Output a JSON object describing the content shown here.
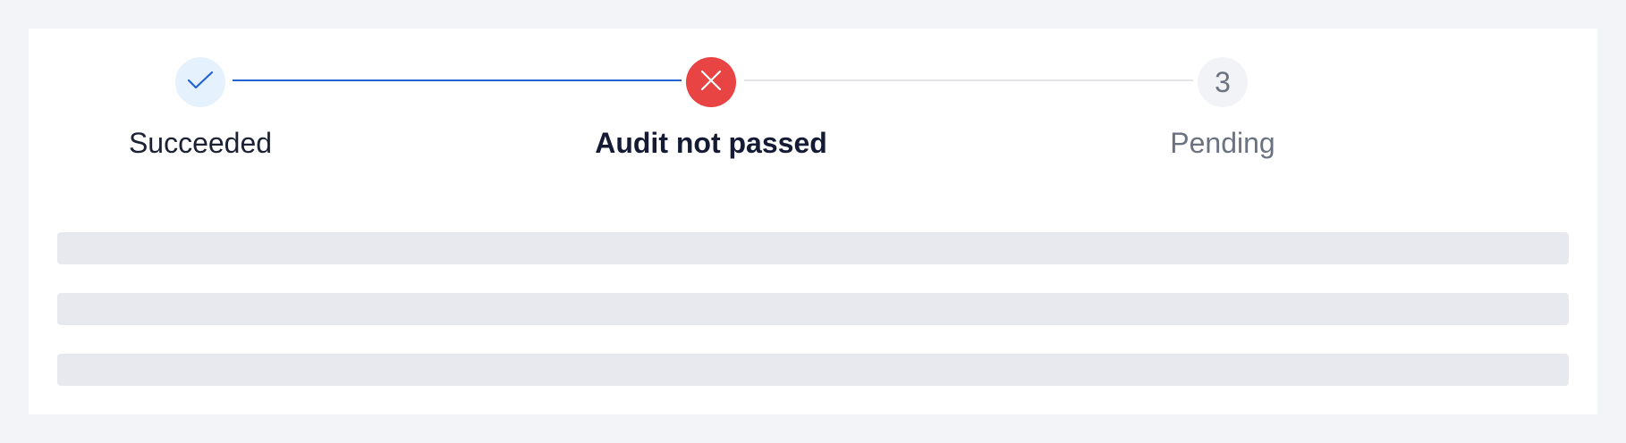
{
  "steps": [
    {
      "label": "Succeeded",
      "status": "done",
      "icon": "check-icon"
    },
    {
      "label": "Audit not passed",
      "status": "error",
      "icon": "close-icon"
    },
    {
      "label": "Pending",
      "status": "pending",
      "number": "3"
    }
  ],
  "colors": {
    "primary": "#2463d3",
    "error": "#e84443",
    "done_bg": "#e5f1fd",
    "pending_bg": "#f2f3f6",
    "skeleton": "#e7e9ee"
  },
  "skeleton_rows": 3
}
